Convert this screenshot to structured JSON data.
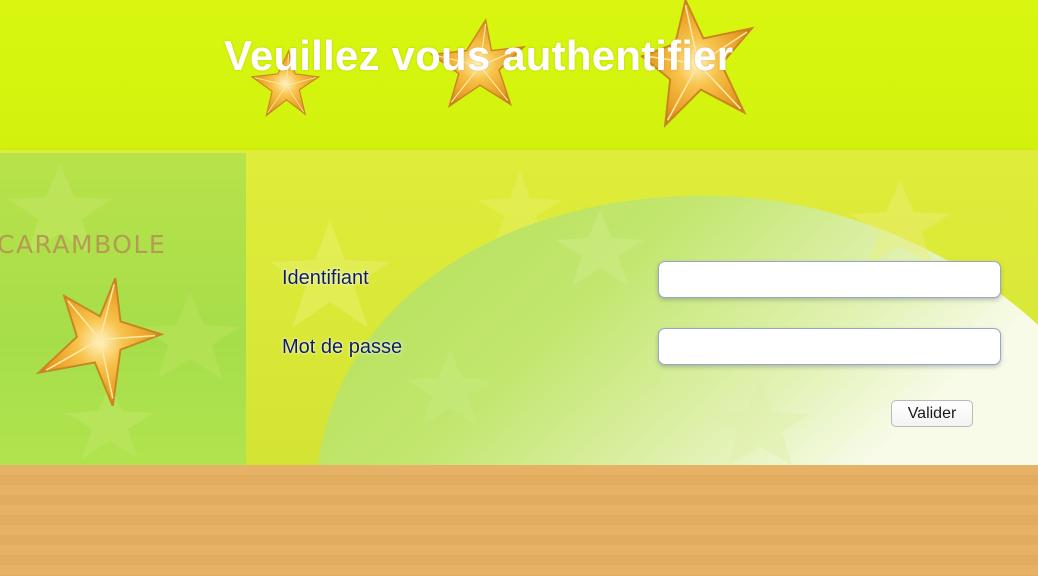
{
  "header": {
    "title": "Veuillez vous authentifier"
  },
  "brand": {
    "name": "CARAMBOLE"
  },
  "form": {
    "identifiant_label": "Identifiant",
    "identifiant_value": "",
    "password_label": "Mot de passe",
    "password_value": "",
    "submit_label": "Valider"
  },
  "colors": {
    "banner": "#d8f60f",
    "band": "#d8e834",
    "logo_panel": "#a6de4a",
    "label_text": "#0f1e5a",
    "bottom": "#e3ab5b"
  },
  "icons": {
    "banner_decoration": "starfruit-icon",
    "logo": "starfruit-icon"
  }
}
